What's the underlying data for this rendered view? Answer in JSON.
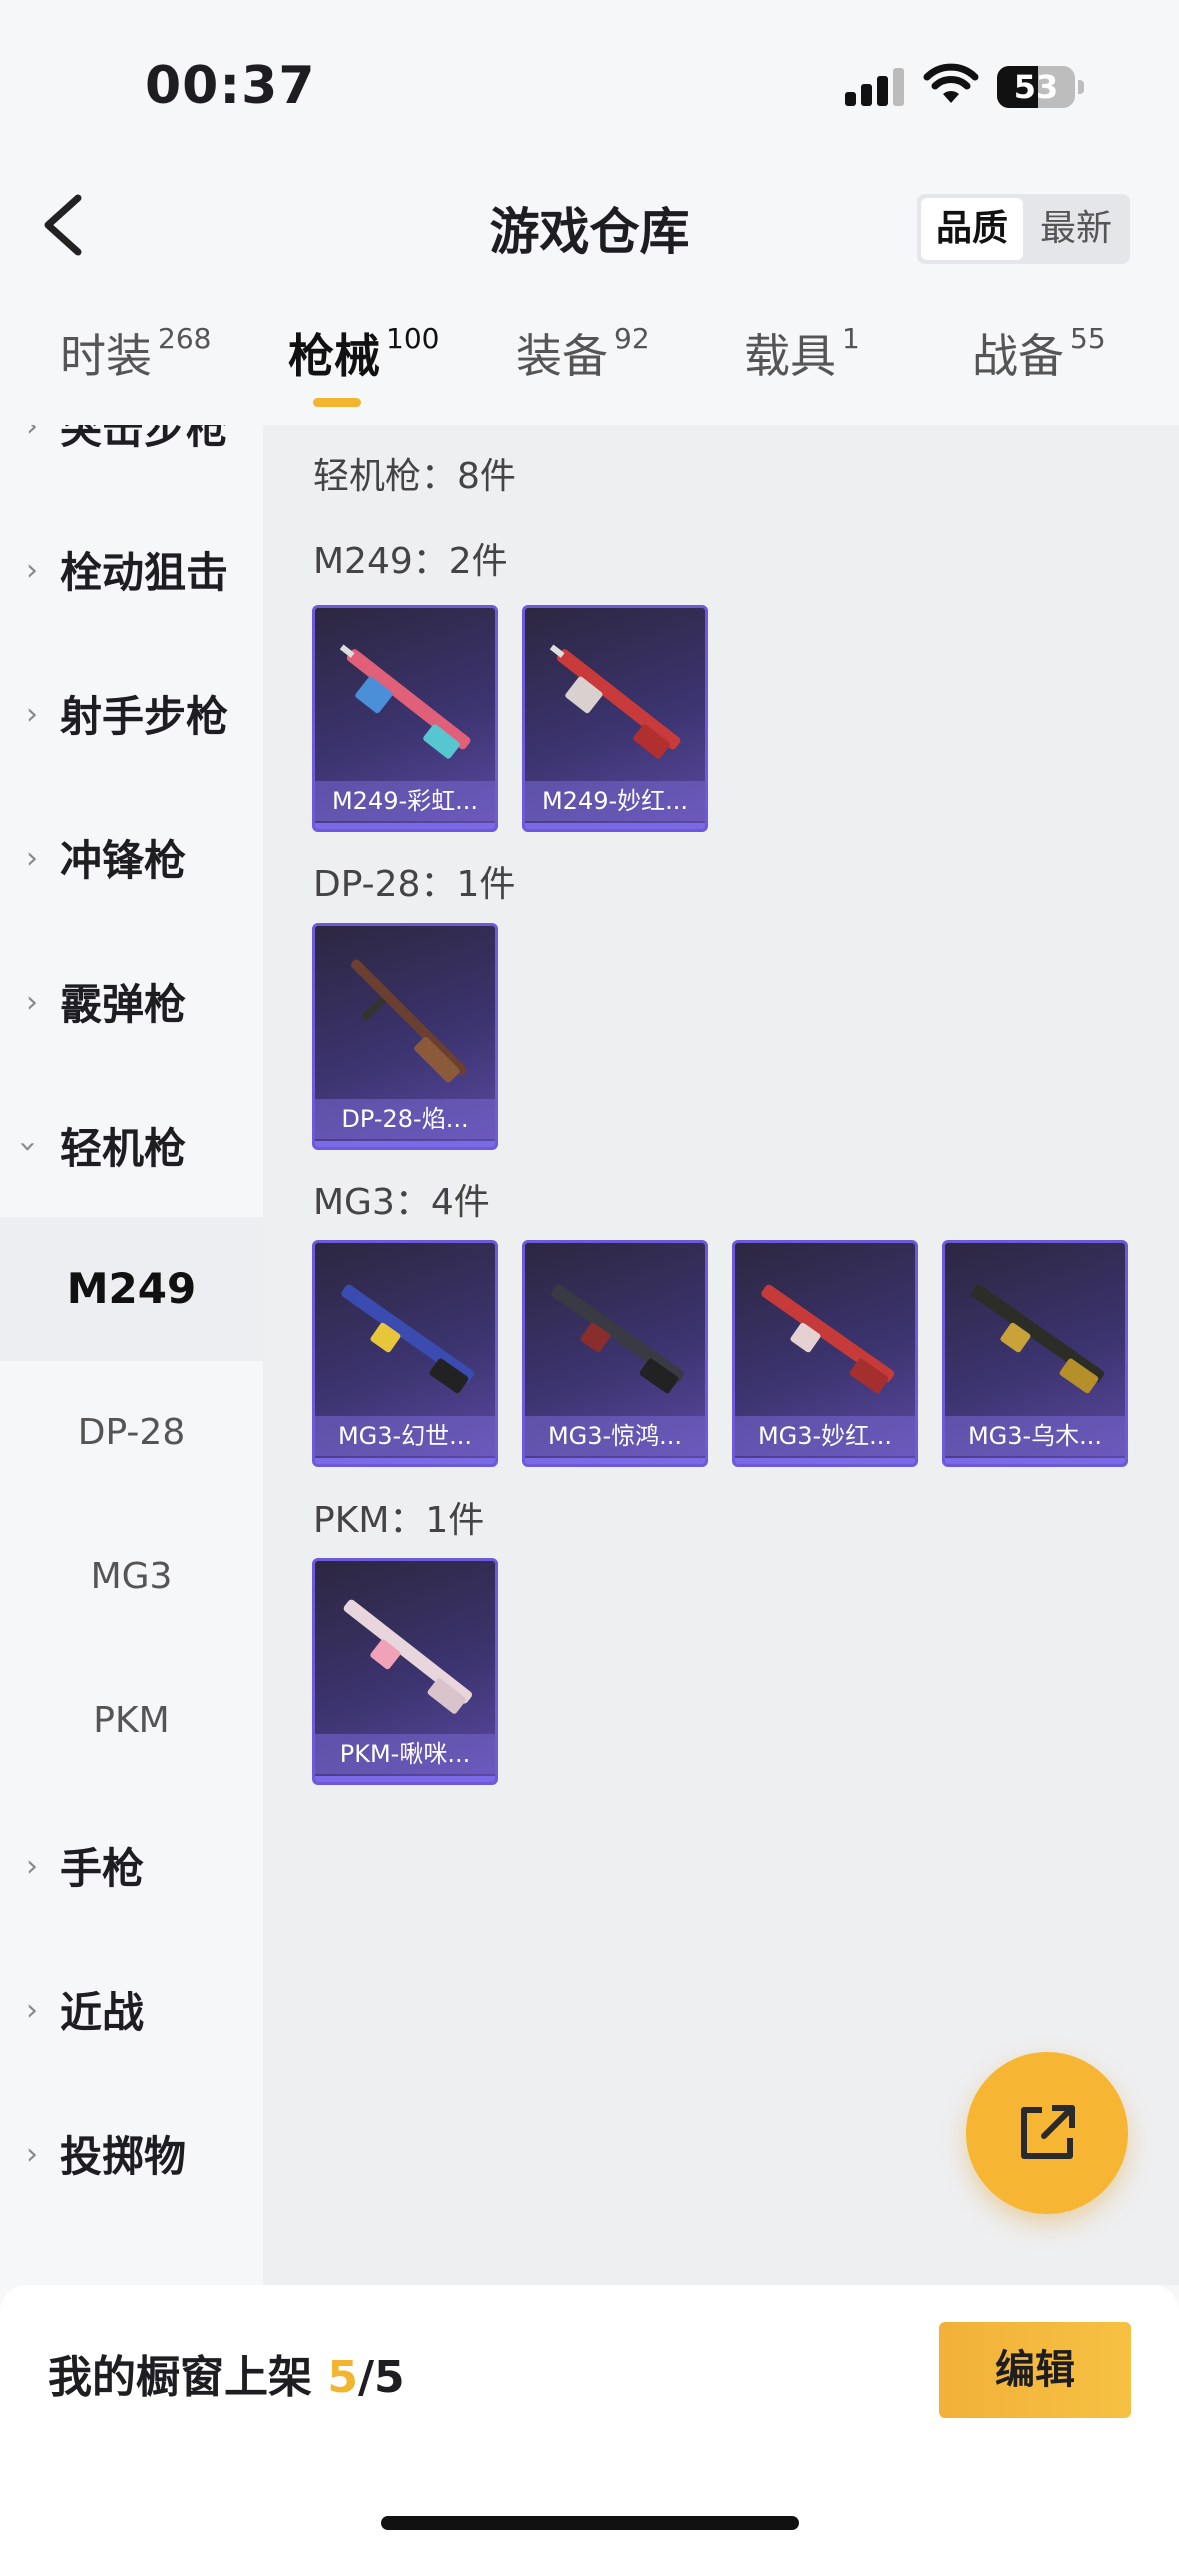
{
  "status_bar": {
    "time": "00:37",
    "battery": "53",
    "battery_level": 0.53
  },
  "header": {
    "title": "游戏仓库",
    "sort_options": [
      "品质",
      "最新"
    ],
    "active_sort": "品质"
  },
  "tabs": [
    {
      "label": "时装",
      "count": "268"
    },
    {
      "label": "枪械",
      "count": "100",
      "active": true
    },
    {
      "label": "装备",
      "count": "92"
    },
    {
      "label": "载具",
      "count": "1"
    },
    {
      "label": "战备",
      "count": "55"
    }
  ],
  "sidebar": {
    "categories": [
      {
        "label": "突击步枪"
      },
      {
        "label": "栓动狙击"
      },
      {
        "label": "射手步枪"
      },
      {
        "label": "冲锋枪"
      },
      {
        "label": "霰弹枪"
      },
      {
        "label": "轻机枪",
        "expanded": true
      },
      {
        "label": "手枪"
      },
      {
        "label": "近战"
      },
      {
        "label": "投掷物"
      }
    ],
    "sub_items": [
      {
        "label": "M249",
        "active": true
      },
      {
        "label": "DP-28"
      },
      {
        "label": "MG3"
      },
      {
        "label": "PKM"
      }
    ]
  },
  "content": {
    "section_title": "轻机枪：8件",
    "groups": [
      {
        "title": "M249：2件",
        "items": [
          "M249-彩虹...",
          "M249-妙红..."
        ]
      },
      {
        "title": "DP-28：1件",
        "items": [
          "DP-28-焰..."
        ]
      },
      {
        "title": "MG3：4件",
        "items": [
          "MG3-幻世...",
          "MG3-惊鸿...",
          "MG3-妙红...",
          "MG3-乌木..."
        ]
      },
      {
        "title": "PKM：1件",
        "items": [
          "PKM-啾咪..."
        ]
      }
    ]
  },
  "bottom_bar": {
    "showcase_label": "我的橱窗上架",
    "showcase_current": "5",
    "showcase_total": "/5",
    "edit_label": "编辑"
  },
  "colors": {
    "accent": "#f3b430",
    "card_border": "#6e5ad8",
    "card_bg": "#3c3470"
  },
  "icons": {
    "back": "chevron-left-icon",
    "share": "external-link-icon"
  }
}
